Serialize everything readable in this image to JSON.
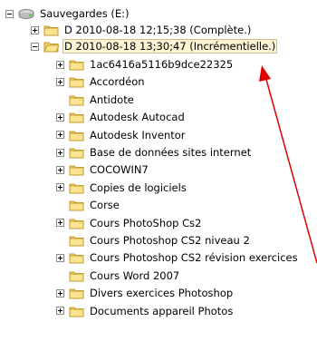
{
  "root": {
    "label": "Sauvegardes (E:)",
    "icon": "drive-icon",
    "expanded": true
  },
  "backups": [
    {
      "label": "D 2010-08-18 12;15;38 (Complète.)",
      "expanded": false,
      "selected": false
    },
    {
      "label": "D 2010-08-18 13;30;47 (Incrémentielle.)",
      "expanded": true,
      "selected": true
    }
  ],
  "folders": [
    {
      "label": "1ac6416a5116b9dce22325",
      "has_children": true
    },
    {
      "label": "Accordéon",
      "has_children": true
    },
    {
      "label": "Antidote",
      "has_children": false
    },
    {
      "label": "Autodesk Autocad",
      "has_children": true
    },
    {
      "label": "Autodesk Inventor",
      "has_children": true
    },
    {
      "label": "Base de données sites internet",
      "has_children": true
    },
    {
      "label": "COCOWIN7",
      "has_children": true
    },
    {
      "label": "Copies de logiciels",
      "has_children": true
    },
    {
      "label": "Corse",
      "has_children": false
    },
    {
      "label": "Cours PhotoShop Cs2",
      "has_children": true
    },
    {
      "label": "Cours Photoshop CS2 niveau 2",
      "has_children": false
    },
    {
      "label": "Cours Photoshop CS2 révision exercices",
      "has_children": true
    },
    {
      "label": "Cours Word 2007",
      "has_children": false
    },
    {
      "label": "Divers exercices Photoshop",
      "has_children": true
    },
    {
      "label": "Documents appareil Photos",
      "has_children": true
    }
  ],
  "colors": {
    "folder_fill": "#f5d76e",
    "folder_stroke": "#c49a2c",
    "selection_bg": "#fbf3d3",
    "annotation_arrow": "#e00000"
  }
}
